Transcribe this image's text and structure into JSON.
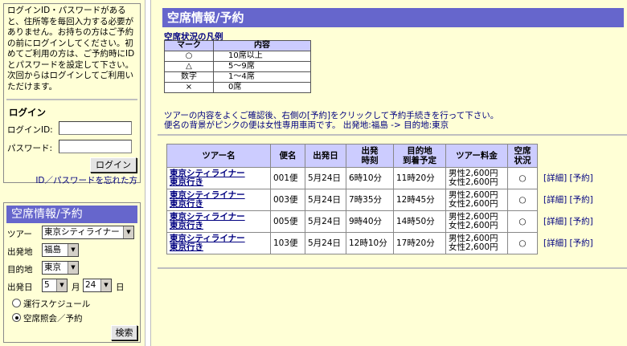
{
  "sidebar": {
    "login_notice": "ログインID・パスワードがあると、住所等を毎回入力する必要がありません。お持ちの方はご予約の前にログインしてください。初めてご利用の方は、ご予約時にIDとパスワードを設定して下さい。次回からはログインしてご利用いただけます。",
    "login_heading": "ログイン",
    "login_id_label": "ログインID:",
    "password_label": "パスワード:",
    "login_button": "ログイン",
    "forgot_link": "ID／パスワードを忘れた方",
    "search_heading": "空席情報/予約",
    "tour_label": "ツアー",
    "tour_value": "東京シティライナー",
    "departure_label": "出発地",
    "departure_value": "福島",
    "destination_label": "目的地",
    "destination_value": "東京",
    "date_label": "出発日",
    "month_value": "5",
    "month_unit": "月",
    "day_value": "24",
    "day_unit": "日",
    "radio_schedule": "運行スケジュール",
    "radio_seat": "空席照会／予約",
    "search_button": "検索"
  },
  "main": {
    "title": "空席情報/予約",
    "legend_title": "空席状況の凡例",
    "legend_headers": [
      "マーク",
      "内容"
    ],
    "legend_rows": [
      {
        "mark": "○",
        "desc": "10席以上"
      },
      {
        "mark": "△",
        "desc": "5～9席"
      },
      {
        "mark": "数字",
        "desc": "1～4席"
      },
      {
        "mark": "×",
        "desc": "0席"
      }
    ],
    "notice_line1": "ツアーの内容をよくご確認後、右側の[予約]をクリックして予約手続きを行って下さい。",
    "notice_line2": "便名の背景がピンクの便は女性専用車両です。 出発地:福島 -> 目的地:東京",
    "table_headers": {
      "tour": "ツアー名",
      "flight": "便名",
      "date": "出発日",
      "depart_1": "出発",
      "depart_2": "時刻",
      "arrive_1": "目的地",
      "arrive_2": "到着予定",
      "fare": "ツアー料金",
      "seats_1": "空席",
      "seats_2": "状況"
    },
    "rows": [
      {
        "tour_1": "東京シティライナー",
        "tour_2": "東京行き",
        "flight": "001便",
        "date": "5月24日",
        "depart": "6時10分",
        "arrive": "11時20分",
        "fare_m": "男性2,600円",
        "fare_f": "女性2,600円",
        "seats": "○",
        "detail": "[詳細]",
        "reserve": "[予約]"
      },
      {
        "tour_1": "東京シティライナー",
        "tour_2": "東京行き",
        "flight": "003便",
        "date": "5月24日",
        "depart": "7時35分",
        "arrive": "12時45分",
        "fare_m": "男性2,600円",
        "fare_f": "女性2,600円",
        "seats": "○",
        "detail": "[詳細]",
        "reserve": "[予約]"
      },
      {
        "tour_1": "東京シティライナー",
        "tour_2": "東京行き",
        "flight": "005便",
        "date": "5月24日",
        "depart": "9時40分",
        "arrive": "14時50分",
        "fare_m": "男性2,600円",
        "fare_f": "女性2,600円",
        "seats": "○",
        "detail": "[詳細]",
        "reserve": "[予約]"
      },
      {
        "tour_1": "東京シティライナー",
        "tour_2": "東京行き",
        "flight": "103便",
        "date": "5月24日",
        "depart": "12時10分",
        "arrive": "17時20分",
        "fare_m": "男性2,600円",
        "fare_f": "女性2,600円",
        "seats": "○",
        "detail": "[詳細]",
        "reserve": "[予約]"
      }
    ]
  },
  "colors": {
    "background": "#FFFFD6",
    "heading_bg": "#6666CC",
    "header_cell_bg": "#CCCCFF",
    "link": "#000080"
  }
}
